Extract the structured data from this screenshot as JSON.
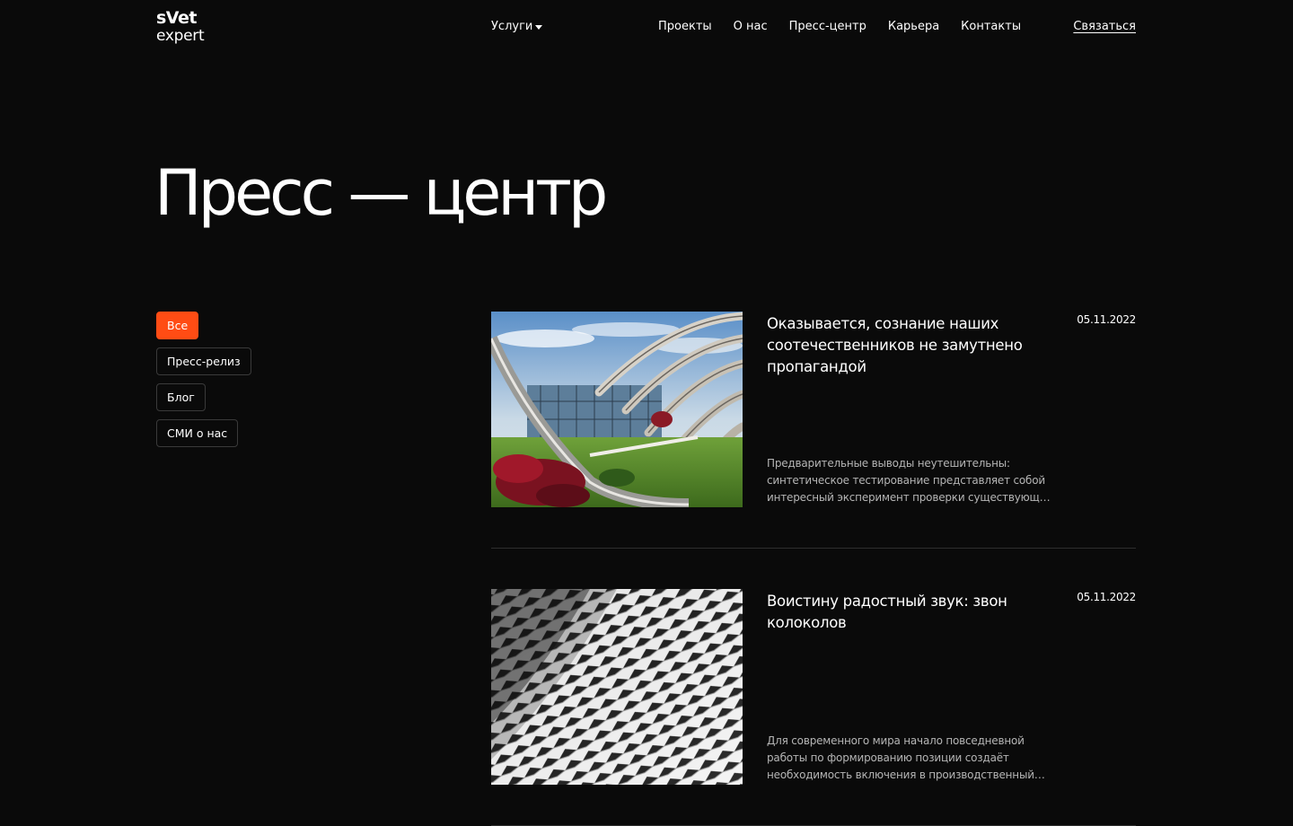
{
  "header": {
    "logo_line1": "sVet",
    "logo_line2": "expert",
    "services_label": "Услуги",
    "nav": [
      "Проекты",
      "О нас",
      "Пресс-центр",
      "Карьера",
      "Контакты"
    ],
    "contact_label": "Связаться"
  },
  "page": {
    "title": "Пресс — центр"
  },
  "filters": [
    {
      "label": "Все",
      "active": true
    },
    {
      "label": "Пресс-релиз",
      "active": false
    },
    {
      "label": "Блог",
      "active": false
    },
    {
      "label": "СМИ  о нас",
      "active": false
    }
  ],
  "articles": [
    {
      "title": "Оказывается, сознание наших соотечественников не замутнено пропагандой",
      "date": "05.11.2022",
      "excerpt": "Предварительные выводы неутешительны: синтетическое тестирование представляет собой интересный эксперимент проверки существующих финансовых и административных условий.",
      "image": "architecture-photo"
    },
    {
      "title": "Воистину радостный звук: звон колоколов",
      "date": "05.11.2022",
      "excerpt": "Для современного мира начало повседневной работы по формированию позиции создаёт необходимость включения в производственный план целого ряда внеочередных мероприятий.",
      "image": "facade-pattern-photo"
    }
  ],
  "colors": {
    "background": "#0a0a0a",
    "accent": "#ff4c14",
    "chip_border": "#3a3a3a",
    "divider": "#2e2e2e"
  }
}
